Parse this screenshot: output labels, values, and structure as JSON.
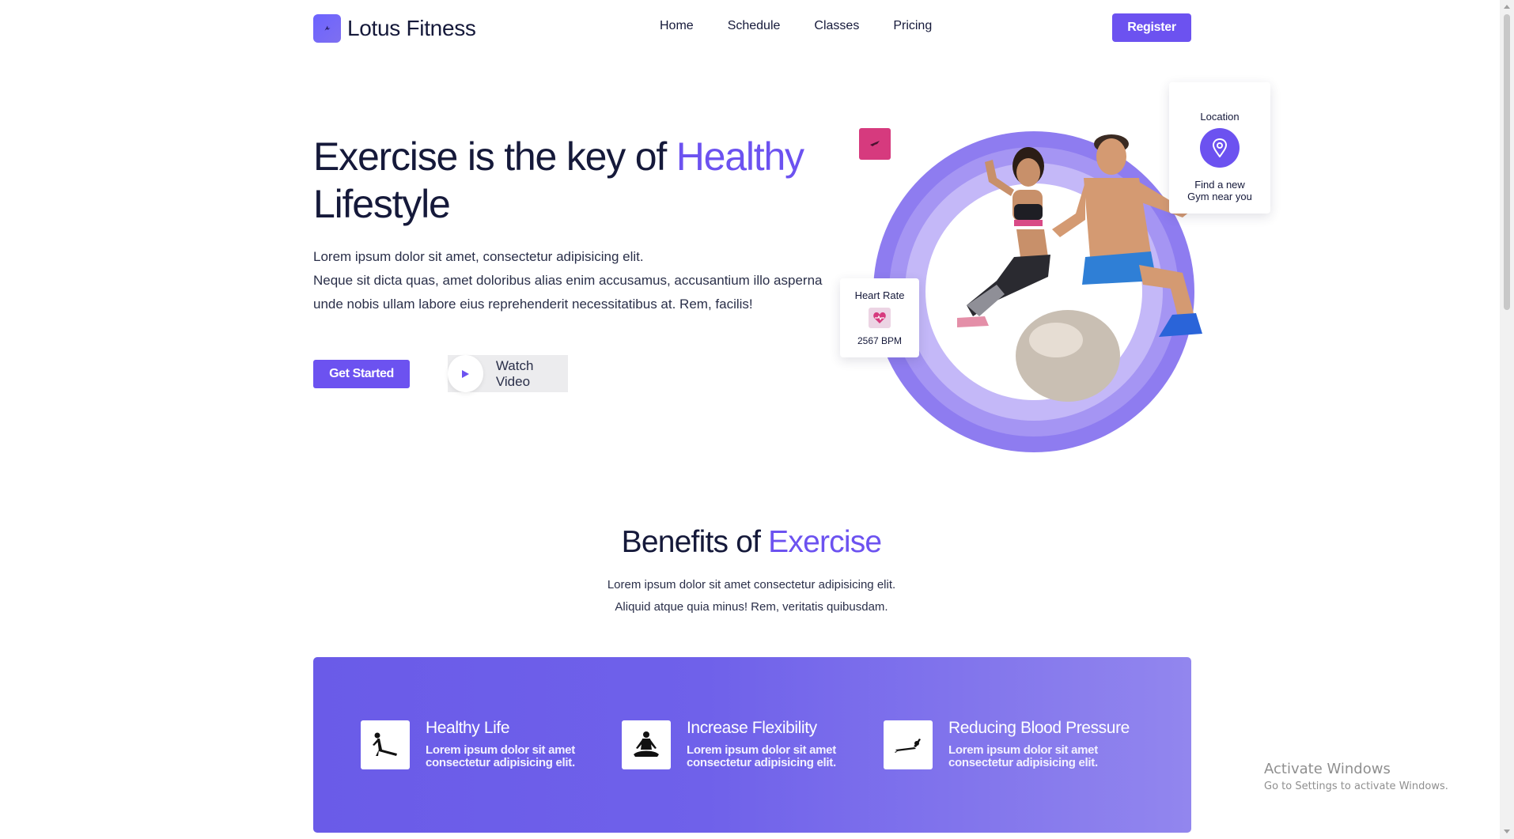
{
  "brand": {
    "name": "Lotus Fitness"
  },
  "nav": {
    "links": [
      "Home",
      "Schedule",
      "Classes",
      "Pricing"
    ],
    "register_label": "Register"
  },
  "hero": {
    "title_part1": "Exercise is the key of ",
    "title_accent": "Healthy",
    "title_part2": "Lifestyle",
    "description_lines": [
      "Lorem ipsum dolor sit amet, consectetur adipisicing elit.",
      "Neque sit dicta quas, amet doloribus alias enim accusamus, accusantium illo asperna",
      "unde nobis ullam labore eius reprehenderit necessitatibus at. Rem, facilis!"
    ],
    "get_started_label": "Get Started",
    "watch_video_label": "Watch Video"
  },
  "heart_rate_card": {
    "title": "Heart Rate",
    "value": "2567 BPM"
  },
  "location_card": {
    "title": "Location",
    "text_line1": "Find a new",
    "text_line2": "Gym near you"
  },
  "benefits": {
    "title_part1": "Benefits of ",
    "title_accent": "Exercise",
    "description_lines": [
      "Lorem ipsum dolor sit amet consectetur adipisicing elit.",
      "Aliquid atque quia minus! Rem, veritatis quibusdam."
    ],
    "items": [
      {
        "title": "Healthy Life",
        "desc_line1": "Lorem ipsum dolor sit amet",
        "desc_line2": "consectetur adipisicing elit.",
        "icon": "plank-pose-icon"
      },
      {
        "title": "Increase Flexibility",
        "desc_line1": "Lorem ipsum dolor sit amet",
        "desc_line2": "consectetur adipisicing elit.",
        "icon": "meditation-pose-icon"
      },
      {
        "title": "Reducing Blood Pressure",
        "desc_line1": "Lorem ipsum dolor sit amet",
        "desc_line2": "consectetur adipisicing elit.",
        "icon": "lying-stretch-icon"
      }
    ]
  },
  "watermark": {
    "line1": "Activate Windows",
    "line2": "Go to Settings to activate Windows."
  },
  "colors": {
    "accent": "#6c52f0",
    "pink": "#d63a7e",
    "panel_start": "#6a5be8",
    "panel_end": "#9286ee",
    "text_dark": "#15193a"
  }
}
